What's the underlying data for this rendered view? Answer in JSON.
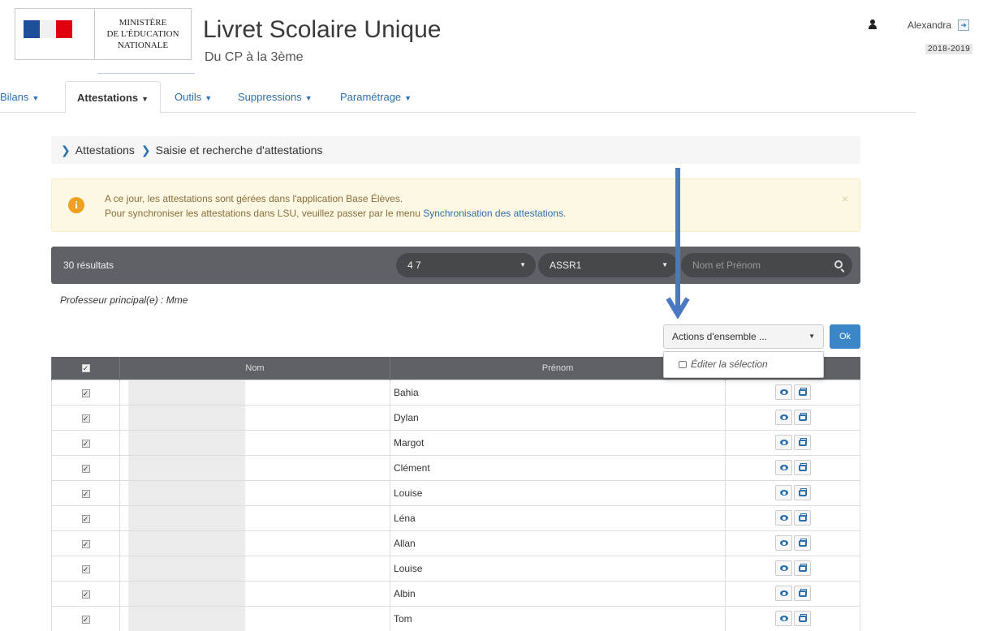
{
  "header": {
    "ministry_lines": [
      "MINISTÈRE",
      "DE L'ÉDUCATION",
      "NATIONALE"
    ],
    "app_title": "Livret Scolaire Unique",
    "app_subtitle": "Du CP à la 3ème",
    "user_name": "Alexandra",
    "school_year": "2018-2019"
  },
  "nav": {
    "items": [
      {
        "label": "Bilans"
      },
      {
        "label": "Attestations"
      },
      {
        "label": "Outils"
      },
      {
        "label": "Suppressions"
      },
      {
        "label": "Paramétrage"
      }
    ],
    "active": "Attestations"
  },
  "breadcrumb": {
    "items": [
      "Attestations",
      "Saisie et recherche d'attestations"
    ]
  },
  "alert": {
    "line1": "A ce jour, les attestations sont gérées dans l'application Base Élèves.",
    "line2_prefix": "Pour synchroniser les attestations dans LSU, veuillez passer par le menu ",
    "line2_link": "Synchronisation des attestations",
    "line2_suffix": "."
  },
  "filter": {
    "result_count": "30 résultats",
    "class_select": "4 7",
    "attestation_select": "ASSR1",
    "search_placeholder": "Nom et Prénom"
  },
  "professeur": "Professeur principal(e) : Mme",
  "actions": {
    "select_label": "Actions d'ensemble ...",
    "ok_label": "Ok",
    "menu_item": "Éditer la sélection"
  },
  "table": {
    "headers": {
      "nom": "Nom",
      "prenom": "Prénom"
    },
    "rows": [
      {
        "prenom": "Bahia"
      },
      {
        "prenom": "Dylan"
      },
      {
        "prenom": "Margot"
      },
      {
        "prenom": "Clément"
      },
      {
        "prenom": "Louise"
      },
      {
        "prenom": "Léna"
      },
      {
        "prenom": "Allan"
      },
      {
        "prenom": "Louise"
      },
      {
        "prenom": "Albin"
      },
      {
        "prenom": "Tom"
      }
    ]
  },
  "colors": {
    "link_blue": "#2c6fad",
    "bar_dark": "#5e6266",
    "alert_bg": "#fcf8e3",
    "annotation_arrow": "#4a78c2",
    "ok_button": "#3a86c8"
  }
}
